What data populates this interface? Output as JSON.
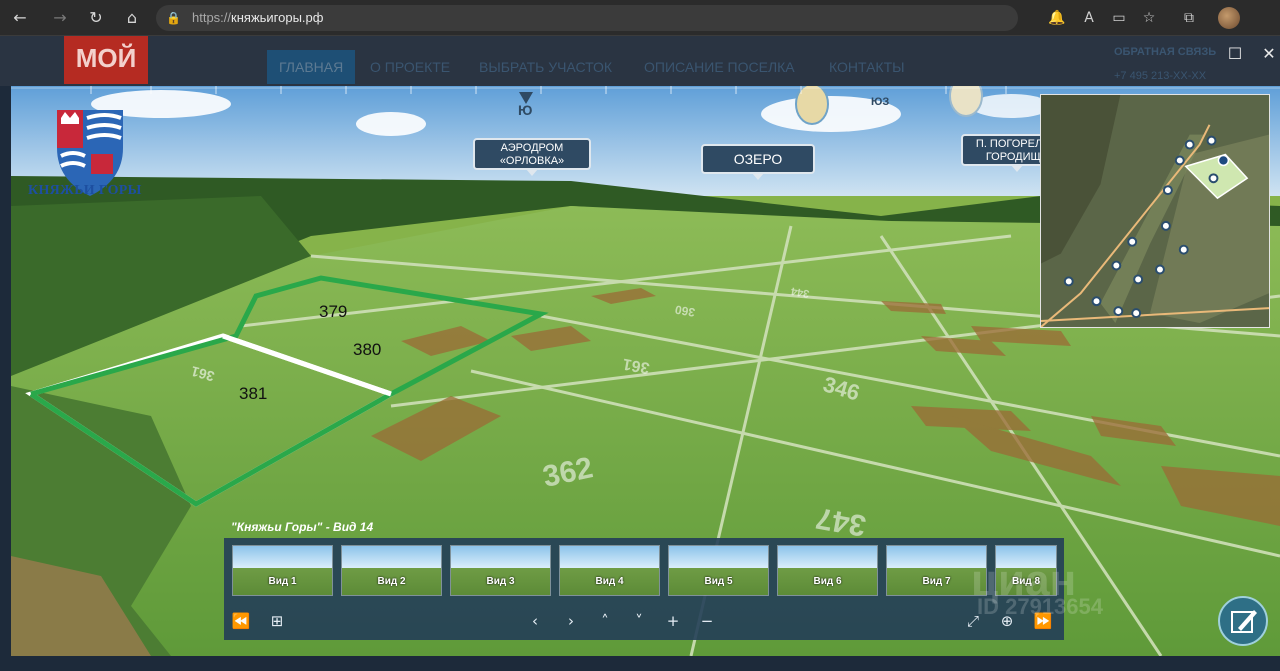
{
  "browser": {
    "url_scheme": "https://",
    "url_host": "княжьигоры.рф"
  },
  "site": {
    "logo_text": "МОЙ",
    "menu": [
      "ГЛАВНАЯ",
      "О ПРОЕКТЕ",
      "ВЫБРАТЬ УЧАСТОК",
      "ОПИСАНИЕ ПОСЕЛКА",
      "КОНТАКТЫ"
    ],
    "feedback_label": "ОБРАТНАЯ СВЯЗЬ",
    "phone": "+7 495 213-XX-XX"
  },
  "viewer": {
    "brand_name": "КНЯЖЬИ ГОРЫ",
    "compass": {
      "south": "Ю",
      "southwest": "ЮЗ"
    },
    "signs": {
      "aerodrome": "АЭРОДРОМ «ОРЛОВКА»",
      "lake": "ОЗЕРО",
      "village": "П. ПОГОРЕЛОЕ ГОРОДИЩЕ"
    },
    "plots": {
      "p379": "379",
      "p380": "380",
      "p381": "381"
    },
    "field_numbers": [
      "362",
      "346",
      "347",
      "361",
      "360",
      "344",
      "361"
    ],
    "view_title": "\"Княжьи Горы\" - Вид 14",
    "thumbnails": [
      "Вид 1",
      "Вид 2",
      "Вид 3",
      "Вид 4",
      "Вид 5",
      "Вид 6",
      "Вид 7",
      "Вид 8"
    ],
    "watermark": "циан",
    "watermark_id": "ID 27913654"
  },
  "icons": {
    "back": "back-arrow-icon",
    "forward": "forward-arrow-icon",
    "reload": "reload-icon",
    "home": "home-icon",
    "lock": "lock-icon",
    "share": "pencil-edit-icon"
  },
  "colors": {
    "sign_bg": "#2f4a63",
    "plot_outline": "#2aa84a",
    "strip_bg": "#243e58"
  }
}
